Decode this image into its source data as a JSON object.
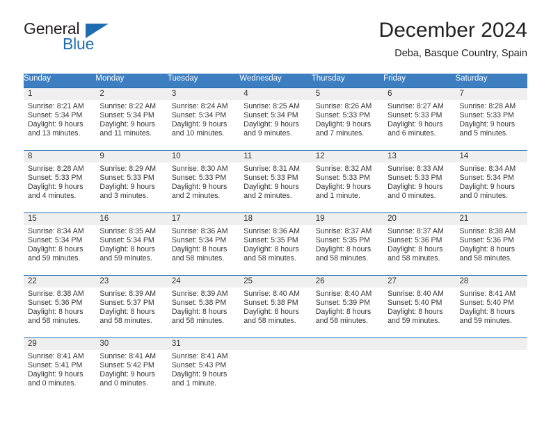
{
  "brand": {
    "name_part1": "General",
    "name_part2": "Blue",
    "flag_icon": "triangle-flag-icon",
    "accent_color": "#1f6cb0"
  },
  "header": {
    "title": "December 2024",
    "subtitle": "Deba, Basque Country, Spain"
  },
  "calendar": {
    "header_bg": "#3c7ebf",
    "daynum_bg": "#efeff0",
    "separator_color": "#1f6cb0",
    "weekdays": [
      "Sunday",
      "Monday",
      "Tuesday",
      "Wednesday",
      "Thursday",
      "Friday",
      "Saturday"
    ],
    "weeks": [
      [
        {
          "day": "1",
          "sunrise": "Sunrise: 8:21 AM",
          "sunset": "Sunset: 5:34 PM",
          "daylight_line1": "Daylight: 9 hours",
          "daylight_line2": "and 13 minutes."
        },
        {
          "day": "2",
          "sunrise": "Sunrise: 8:22 AM",
          "sunset": "Sunset: 5:34 PM",
          "daylight_line1": "Daylight: 9 hours",
          "daylight_line2": "and 11 minutes."
        },
        {
          "day": "3",
          "sunrise": "Sunrise: 8:24 AM",
          "sunset": "Sunset: 5:34 PM",
          "daylight_line1": "Daylight: 9 hours",
          "daylight_line2": "and 10 minutes."
        },
        {
          "day": "4",
          "sunrise": "Sunrise: 8:25 AM",
          "sunset": "Sunset: 5:34 PM",
          "daylight_line1": "Daylight: 9 hours",
          "daylight_line2": "and 9 minutes."
        },
        {
          "day": "5",
          "sunrise": "Sunrise: 8:26 AM",
          "sunset": "Sunset: 5:33 PM",
          "daylight_line1": "Daylight: 9 hours",
          "daylight_line2": "and 7 minutes."
        },
        {
          "day": "6",
          "sunrise": "Sunrise: 8:27 AM",
          "sunset": "Sunset: 5:33 PM",
          "daylight_line1": "Daylight: 9 hours",
          "daylight_line2": "and 6 minutes."
        },
        {
          "day": "7",
          "sunrise": "Sunrise: 8:28 AM",
          "sunset": "Sunset: 5:33 PM",
          "daylight_line1": "Daylight: 9 hours",
          "daylight_line2": "and 5 minutes."
        }
      ],
      [
        {
          "day": "8",
          "sunrise": "Sunrise: 8:28 AM",
          "sunset": "Sunset: 5:33 PM",
          "daylight_line1": "Daylight: 9 hours",
          "daylight_line2": "and 4 minutes."
        },
        {
          "day": "9",
          "sunrise": "Sunrise: 8:29 AM",
          "sunset": "Sunset: 5:33 PM",
          "daylight_line1": "Daylight: 9 hours",
          "daylight_line2": "and 3 minutes."
        },
        {
          "day": "10",
          "sunrise": "Sunrise: 8:30 AM",
          "sunset": "Sunset: 5:33 PM",
          "daylight_line1": "Daylight: 9 hours",
          "daylight_line2": "and 2 minutes."
        },
        {
          "day": "11",
          "sunrise": "Sunrise: 8:31 AM",
          "sunset": "Sunset: 5:33 PM",
          "daylight_line1": "Daylight: 9 hours",
          "daylight_line2": "and 2 minutes."
        },
        {
          "day": "12",
          "sunrise": "Sunrise: 8:32 AM",
          "sunset": "Sunset: 5:33 PM",
          "daylight_line1": "Daylight: 9 hours",
          "daylight_line2": "and 1 minute."
        },
        {
          "day": "13",
          "sunrise": "Sunrise: 8:33 AM",
          "sunset": "Sunset: 5:33 PM",
          "daylight_line1": "Daylight: 9 hours",
          "daylight_line2": "and 0 minutes."
        },
        {
          "day": "14",
          "sunrise": "Sunrise: 8:34 AM",
          "sunset": "Sunset: 5:34 PM",
          "daylight_line1": "Daylight: 9 hours",
          "daylight_line2": "and 0 minutes."
        }
      ],
      [
        {
          "day": "15",
          "sunrise": "Sunrise: 8:34 AM",
          "sunset": "Sunset: 5:34 PM",
          "daylight_line1": "Daylight: 8 hours",
          "daylight_line2": "and 59 minutes."
        },
        {
          "day": "16",
          "sunrise": "Sunrise: 8:35 AM",
          "sunset": "Sunset: 5:34 PM",
          "daylight_line1": "Daylight: 8 hours",
          "daylight_line2": "and 59 minutes."
        },
        {
          "day": "17",
          "sunrise": "Sunrise: 8:36 AM",
          "sunset": "Sunset: 5:34 PM",
          "daylight_line1": "Daylight: 8 hours",
          "daylight_line2": "and 58 minutes."
        },
        {
          "day": "18",
          "sunrise": "Sunrise: 8:36 AM",
          "sunset": "Sunset: 5:35 PM",
          "daylight_line1": "Daylight: 8 hours",
          "daylight_line2": "and 58 minutes."
        },
        {
          "day": "19",
          "sunrise": "Sunrise: 8:37 AM",
          "sunset": "Sunset: 5:35 PM",
          "daylight_line1": "Daylight: 8 hours",
          "daylight_line2": "and 58 minutes."
        },
        {
          "day": "20",
          "sunrise": "Sunrise: 8:37 AM",
          "sunset": "Sunset: 5:36 PM",
          "daylight_line1": "Daylight: 8 hours",
          "daylight_line2": "and 58 minutes."
        },
        {
          "day": "21",
          "sunrise": "Sunrise: 8:38 AM",
          "sunset": "Sunset: 5:36 PM",
          "daylight_line1": "Daylight: 8 hours",
          "daylight_line2": "and 58 minutes."
        }
      ],
      [
        {
          "day": "22",
          "sunrise": "Sunrise: 8:38 AM",
          "sunset": "Sunset: 5:36 PM",
          "daylight_line1": "Daylight: 8 hours",
          "daylight_line2": "and 58 minutes."
        },
        {
          "day": "23",
          "sunrise": "Sunrise: 8:39 AM",
          "sunset": "Sunset: 5:37 PM",
          "daylight_line1": "Daylight: 8 hours",
          "daylight_line2": "and 58 minutes."
        },
        {
          "day": "24",
          "sunrise": "Sunrise: 8:39 AM",
          "sunset": "Sunset: 5:38 PM",
          "daylight_line1": "Daylight: 8 hours",
          "daylight_line2": "and 58 minutes."
        },
        {
          "day": "25",
          "sunrise": "Sunrise: 8:40 AM",
          "sunset": "Sunset: 5:38 PM",
          "daylight_line1": "Daylight: 8 hours",
          "daylight_line2": "and 58 minutes."
        },
        {
          "day": "26",
          "sunrise": "Sunrise: 8:40 AM",
          "sunset": "Sunset: 5:39 PM",
          "daylight_line1": "Daylight: 8 hours",
          "daylight_line2": "and 58 minutes."
        },
        {
          "day": "27",
          "sunrise": "Sunrise: 8:40 AM",
          "sunset": "Sunset: 5:40 PM",
          "daylight_line1": "Daylight: 8 hours",
          "daylight_line2": "and 59 minutes."
        },
        {
          "day": "28",
          "sunrise": "Sunrise: 8:41 AM",
          "sunset": "Sunset: 5:40 PM",
          "daylight_line1": "Daylight: 8 hours",
          "daylight_line2": "and 59 minutes."
        }
      ],
      [
        {
          "day": "29",
          "sunrise": "Sunrise: 8:41 AM",
          "sunset": "Sunset: 5:41 PM",
          "daylight_line1": "Daylight: 9 hours",
          "daylight_line2": "and 0 minutes."
        },
        {
          "day": "30",
          "sunrise": "Sunrise: 8:41 AM",
          "sunset": "Sunset: 5:42 PM",
          "daylight_line1": "Daylight: 9 hours",
          "daylight_line2": "and 0 minutes."
        },
        {
          "day": "31",
          "sunrise": "Sunrise: 8:41 AM",
          "sunset": "Sunset: 5:43 PM",
          "daylight_line1": "Daylight: 9 hours",
          "daylight_line2": "and 1 minute."
        },
        {
          "day": "",
          "sunrise": "",
          "sunset": "",
          "daylight_line1": "",
          "daylight_line2": ""
        },
        {
          "day": "",
          "sunrise": "",
          "sunset": "",
          "daylight_line1": "",
          "daylight_line2": ""
        },
        {
          "day": "",
          "sunrise": "",
          "sunset": "",
          "daylight_line1": "",
          "daylight_line2": ""
        },
        {
          "day": "",
          "sunrise": "",
          "sunset": "",
          "daylight_line1": "",
          "daylight_line2": ""
        }
      ]
    ]
  }
}
